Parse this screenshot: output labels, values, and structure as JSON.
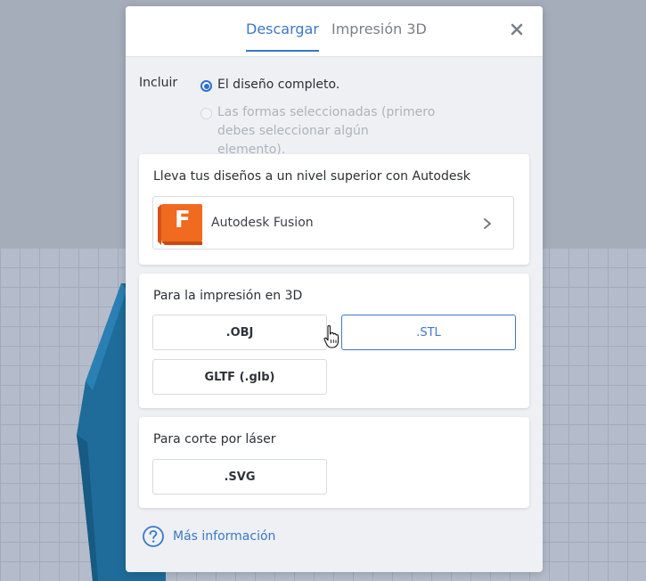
{
  "modal": {
    "tabs": [
      {
        "label": "Descargar",
        "active": true
      },
      {
        "label": "Impresión 3D",
        "active": false
      }
    ],
    "close_icon": "close-icon"
  },
  "include": {
    "label": "Incluir",
    "options": [
      {
        "label": "El diseño completo.",
        "selected": true,
        "enabled": true
      },
      {
        "label": "Las formas seleccionadas (primero debes seleccionar algún elemento).",
        "selected": false,
        "enabled": false
      }
    ]
  },
  "autodesk": {
    "title": "Lleva tus diseños a un nivel superior con Autodesk",
    "product_label": "Autodesk Fusion",
    "logo_letter": "F"
  },
  "print3d": {
    "title": "Para la impresión en 3D",
    "buttons": [
      ".OBJ",
      ".STL",
      "GLTF (.glb)"
    ]
  },
  "laser": {
    "title": "Para corte por láser",
    "buttons": [
      ".SVG"
    ]
  },
  "footer": {
    "more_info_label": "Más información"
  },
  "colors": {
    "accent": "#3b78c6",
    "fusion_orange": "#f06a1f",
    "backdrop": "#a5adbb",
    "shape_blue": "#1f6c9a"
  }
}
